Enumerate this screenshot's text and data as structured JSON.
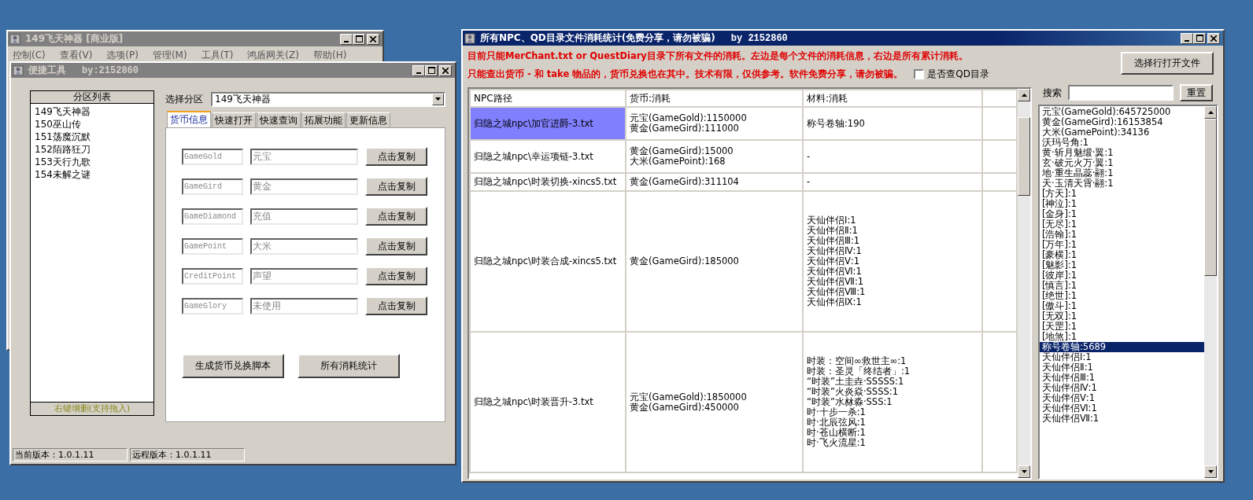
{
  "main_window": {
    "title": "149飞天神器 [商业版]",
    "active": false,
    "menu": [
      "控制(C)",
      "查看(V)",
      "选项(P)",
      "管理(M)",
      "工具(T)",
      "鸿盾网关(Z)",
      "帮助(H)"
    ]
  },
  "tool_window": {
    "title": "便捷工具",
    "author": "by:2152860",
    "active": false,
    "partition_list": {
      "header": "分区列表",
      "items": [
        "149飞天神器",
        "150巫山传",
        "151荡魔沉默",
        "152陌路狂刀",
        "153天行九歌",
        "154未解之谜"
      ],
      "footer": "右键增删(支持拖入)"
    },
    "partition_select": {
      "label": "选择分区",
      "value": "149飞天神器"
    },
    "tabs": [
      {
        "label": "货币信息",
        "selected": true
      },
      {
        "label": "快速打开",
        "selected": false
      },
      {
        "label": "快速查询",
        "selected": false
      },
      {
        "label": "拓展功能",
        "selected": false
      },
      {
        "label": "更新信息",
        "selected": false
      }
    ],
    "currency_rows": [
      {
        "code": "GameGold",
        "name": "元宝",
        "button": "点击复制"
      },
      {
        "code": "GameGird",
        "name": "黄金",
        "button": "点击复制"
      },
      {
        "code": "GameDiamond",
        "name": "充值",
        "button": "点击复制"
      },
      {
        "code": "GamePoint",
        "name": "大米",
        "button": "点击复制"
      },
      {
        "code": "CreditPoint",
        "name": "声望",
        "button": "点击复制"
      },
      {
        "code": "GameGlory",
        "name": "未使用",
        "button": "点击复制"
      }
    ],
    "actions": [
      "生成货币兑换脚本",
      "所有消耗统计"
    ],
    "status_bar": [
      "当前版本：1.0.1.11",
      "远程版本：1.0.1.11"
    ]
  },
  "stats_window": {
    "title": "所有NPC、QD目录文件消耗统计(免费分享，请勿被骗)",
    "author": "by 2152860",
    "active": true,
    "notices": [
      "目前只能MerChant.txt or QuestDiary目录下所有文件的消耗。左边是每个文件的消耗信息，右边是所有累计消耗。",
      "只能查出货币 - 和 take 物品的，货币兑换也在其中。技术有限，仅供参考。软件免费分享，请勿被骗。"
    ],
    "qd_checkbox": {
      "label": "是否查QD目录",
      "checked": false
    },
    "open_button": "选择行打开文件",
    "table": {
      "columns": [
        "NPC路径",
        "货币:消耗",
        "材料:消耗"
      ],
      "rows": [
        {
          "path": "归隐之城npc\\加官进爵-3.txt",
          "selected": true,
          "currency": [
            "元宝(GameGold):1150000",
            "黄金(GameGird):111000"
          ],
          "materials": [
            "称号卷轴:190"
          ]
        },
        {
          "path": "归隐之城npc\\幸运项链-3.txt",
          "selected": false,
          "currency": [
            "黄金(GameGird):15000",
            "大米(GamePoint):168"
          ],
          "materials": [
            "-"
          ]
        },
        {
          "path": "归隐之城npc\\时装切换-xincs5.txt",
          "selected": false,
          "currency": [
            "黄金(GameGird):311104"
          ],
          "materials": [
            "-"
          ]
        },
        {
          "path": "归隐之城npc\\时装合成-xincs5.txt",
          "selected": false,
          "currency": [
            "黄金(GameGird):185000"
          ],
          "materials": [
            "天仙伴侣Ⅰ:1",
            "天仙伴侣Ⅱ:1",
            "天仙伴侣Ⅲ:1",
            "天仙伴侣Ⅳ:1",
            "天仙伴侣Ⅴ:1",
            "天仙伴侣Ⅵ:1",
            "天仙伴侣Ⅶ:1",
            "天仙伴侣Ⅷ:1",
            "天仙伴侣Ⅸ:1"
          ]
        },
        {
          "path": "归隐之城npc\\时装晋升-3.txt",
          "selected": false,
          "currency": [
            "元宝(GameGold):1850000",
            "黄金(GameGird):450000"
          ],
          "materials": [
            "时装：空间∞救世主∞:1",
            "时装：圣灵「终结者」:1",
            "“时装”土圭垚·SSSSS:1",
            "“时装”火炎焱·SSSS:1",
            "“时装”水沝淼·SSS:1",
            "时·十步一杀:1",
            "时·北辰弦风:1",
            "时·苍山横断:1",
            "时·飞火流星:1"
          ]
        }
      ]
    },
    "search": {
      "label": "搜索",
      "reset": "重置"
    },
    "totals": [
      {
        "text": "元宝(GameGold):645725000",
        "selected": false
      },
      {
        "text": "黄金(GameGird):16153854",
        "selected": false
      },
      {
        "text": "大米(GamePoint):34136",
        "selected": false
      },
      {
        "text": "沃玛号角:1",
        "selected": false
      },
      {
        "text": "黄·斩月魅缎·翼:1",
        "selected": false
      },
      {
        "text": "玄·破元火万·翼:1",
        "selected": false
      },
      {
        "text": "地·重生晶蕊·翮:1",
        "selected": false
      },
      {
        "text": "天·玉清天霄·翮:1",
        "selected": false
      },
      {
        "text": "[方天]:1",
        "selected": false
      },
      {
        "text": "[神泣]:1",
        "selected": false
      },
      {
        "text": "[金身]:1",
        "selected": false
      },
      {
        "text": "[无尽]:1",
        "selected": false
      },
      {
        "text": "[浩翰]:1",
        "selected": false
      },
      {
        "text": "[万年]:1",
        "selected": false
      },
      {
        "text": "[豪横]:1",
        "selected": false
      },
      {
        "text": "[魅影]:1",
        "selected": false
      },
      {
        "text": "[彼岸]:1",
        "selected": false
      },
      {
        "text": "[慎言]:1",
        "selected": false
      },
      {
        "text": "[绝世]:1",
        "selected": false
      },
      {
        "text": "[傲斗]:1",
        "selected": false
      },
      {
        "text": "[无双]:1",
        "selected": false
      },
      {
        "text": "[天罡]:1",
        "selected": false
      },
      {
        "text": "[地煞]:1",
        "selected": false
      },
      {
        "text": "称号卷轴:5689",
        "selected": true
      },
      {
        "text": "天仙伴侣Ⅰ:1",
        "selected": false
      },
      {
        "text": "天仙伴侣Ⅱ:1",
        "selected": false
      },
      {
        "text": "天仙伴侣Ⅲ:1",
        "selected": false
      },
      {
        "text": "天仙伴侣Ⅳ:1",
        "selected": false
      },
      {
        "text": "天仙伴侣Ⅴ:1",
        "selected": false
      },
      {
        "text": "天仙伴侣Ⅵ:1",
        "selected": false
      },
      {
        "text": "天仙伴侣Ⅶ:1",
        "selected": false
      }
    ]
  }
}
